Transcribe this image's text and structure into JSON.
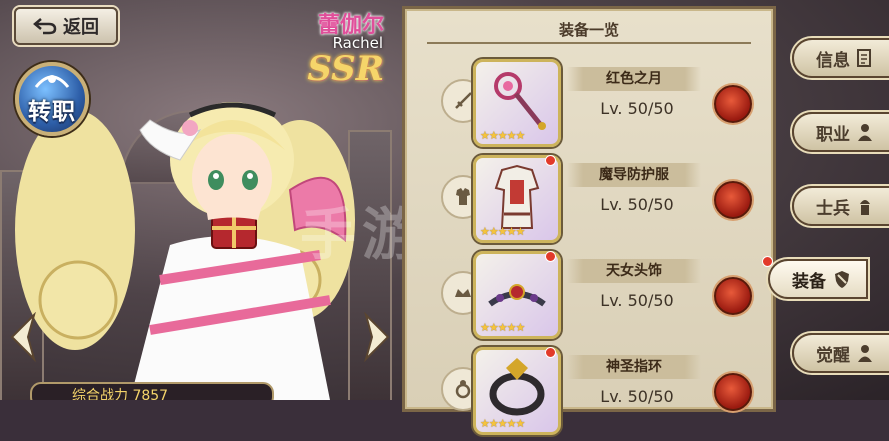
{
  "header": {
    "back_label": "返回",
    "job_change_label": "转职"
  },
  "character": {
    "name_cn": "蕾伽尔",
    "name_en": "Rachel",
    "rarity": "SSR",
    "power_label": "综合战力",
    "power_value": "7857"
  },
  "panel": {
    "title": "装备一览",
    "items": [
      {
        "slot": "sword-icon",
        "name": "红色之月",
        "level": "Lv. 50/50",
        "stars": "★★★★★",
        "has_alert": false
      },
      {
        "slot": "armor-icon",
        "name": "魔导防护服",
        "level": "Lv. 50/50",
        "stars": "★★★★★",
        "has_alert": true
      },
      {
        "slot": "tiara-icon",
        "name": "天女头饰",
        "level": "Lv. 50/50",
        "stars": "★★★★★",
        "has_alert": true
      },
      {
        "slot": "ring-icon",
        "name": "神圣指环",
        "level": "Lv. 50/50",
        "stars": "★★★★★",
        "has_alert": true
      }
    ]
  },
  "tabs": [
    {
      "label": "信息",
      "icon": "document-icon",
      "active": false
    },
    {
      "label": "职业",
      "icon": "person-icon",
      "active": false
    },
    {
      "label": "士兵",
      "icon": "soldier-icon",
      "active": false
    },
    {
      "label": "装备",
      "icon": "shield-icon",
      "active": true
    },
    {
      "label": "觉醒",
      "icon": "person-icon",
      "active": false
    }
  ],
  "watermark": "手游"
}
